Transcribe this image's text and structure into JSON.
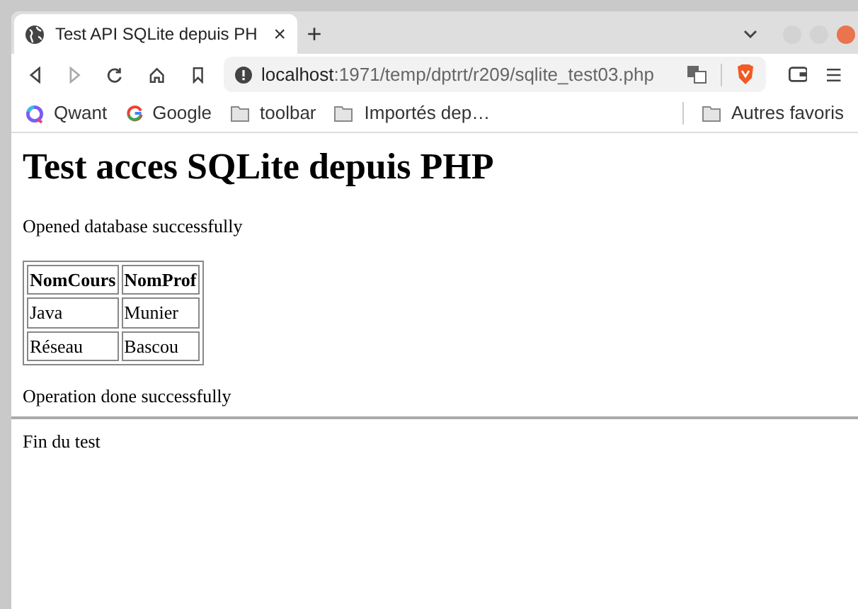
{
  "tab": {
    "title": "Test API SQLite depuis PH",
    "close": "×",
    "selected": true
  },
  "new_tab": "+",
  "address": {
    "host": "localhost",
    "path": ":1971/temp/dptrt/r209/sqlite_test03.php"
  },
  "bookmarks": [
    {
      "label": "Qwant",
      "kind": "qwant"
    },
    {
      "label": "Google",
      "kind": "google"
    },
    {
      "label": "toolbar",
      "kind": "folder"
    },
    {
      "label": "Importés dep…",
      "kind": "folder"
    }
  ],
  "other_bookmarks": "Autres favoris",
  "page": {
    "heading": "Test acces SQLite depuis PHP",
    "message_1": "Opened database successfully",
    "table": {
      "columns": [
        "NomCours",
        "NomProf"
      ],
      "rows": [
        [
          "Java",
          "Munier"
        ],
        [
          "Réseau",
          "Bascou"
        ]
      ]
    },
    "message_2": "Operation done successfully",
    "footer": "Fin du test"
  }
}
